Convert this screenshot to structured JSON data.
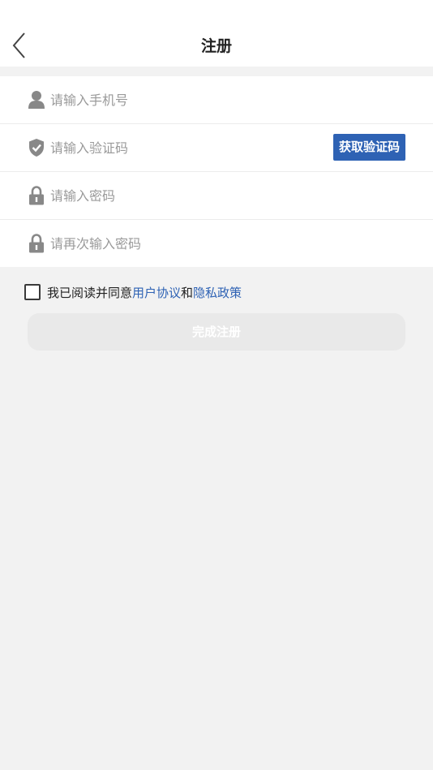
{
  "header": {
    "title": "注册",
    "back_icon": "chevron-left-icon"
  },
  "form": {
    "phone": {
      "icon": "user-icon",
      "placeholder": "请输入手机号",
      "value": ""
    },
    "code": {
      "icon": "shield-check-icon",
      "placeholder": "请输入验证码",
      "value": "",
      "button_label": "获取验证码"
    },
    "password": {
      "icon": "lock-icon",
      "placeholder": "请输入密码",
      "value": ""
    },
    "password_confirm": {
      "icon": "lock-icon",
      "placeholder": "请再次输入密码",
      "value": ""
    }
  },
  "agreement": {
    "checked": false,
    "prefix": "我已阅读并同意",
    "user_agreement": "用户协议",
    "joiner": "和",
    "privacy_policy": "隐私政策"
  },
  "submit": {
    "label": "完成注册",
    "enabled": false
  },
  "colors": {
    "accent": "#2e62b4",
    "background": "#f2f2f2",
    "disabled_button": "#e9e9e9",
    "icon": "#888888"
  }
}
